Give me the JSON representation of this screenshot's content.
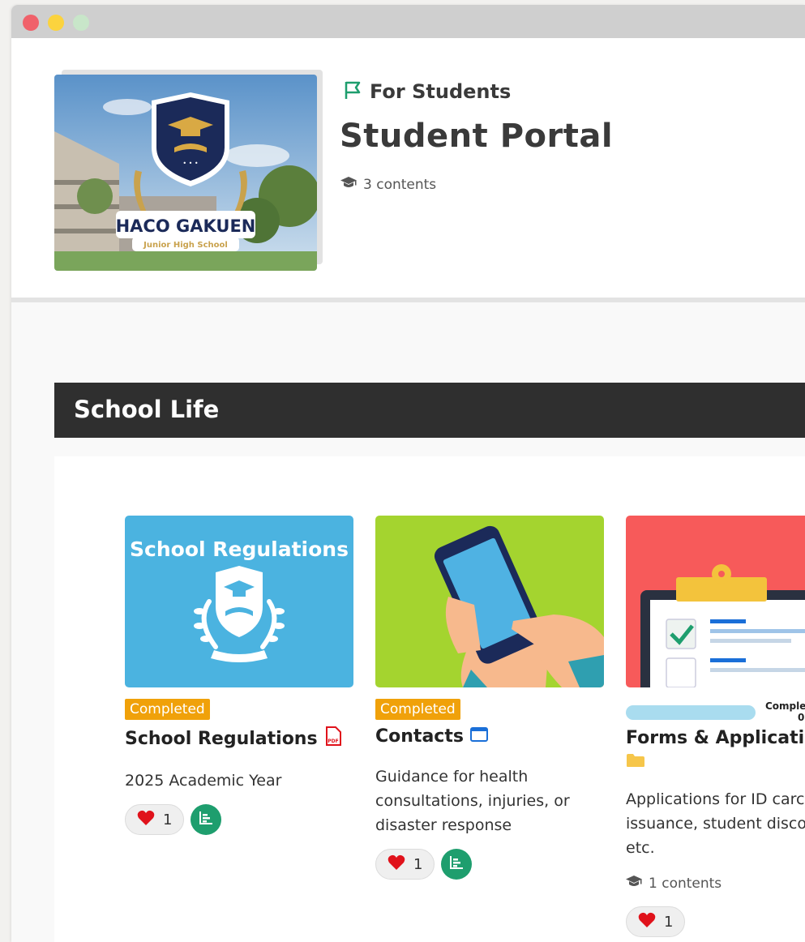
{
  "category": {
    "label": "For Students",
    "icon": "flag-icon"
  },
  "title": "Student Portal",
  "content_count": "3 contents",
  "cover": {
    "school_name": "HACO GAKUEN",
    "school_subtitle": "Junior High School"
  },
  "section": {
    "title": "School Life"
  },
  "cards": [
    {
      "thumb_text": "School Regulations",
      "badge": "Completed",
      "title": "School Regulations",
      "type_icon": "pdf-icon",
      "description": "2025 Academic Year",
      "likes": "1",
      "thumb_color": "#4bb3e0"
    },
    {
      "badge": "Completed",
      "title": "Contacts",
      "type_icon": "browser-window-icon",
      "description": "Guidance for health consultations, injuries, or disaster response",
      "likes": "1",
      "thumb_color": "#a4d42f"
    },
    {
      "progress_label": "Comple",
      "progress_value": "0",
      "title": "Forms & Applicatic",
      "type_icon": "folder-icon",
      "description": "Applications for ID carc issuance, student disco etc.",
      "content_count": "1 contents",
      "likes": "1",
      "thumb_color": "#f75a5a"
    }
  ],
  "colors": {
    "badge": "#f0a10a",
    "accent_green": "#1e9e6e",
    "heart": "#e0121b",
    "section_bar": "#2f2f2f"
  }
}
